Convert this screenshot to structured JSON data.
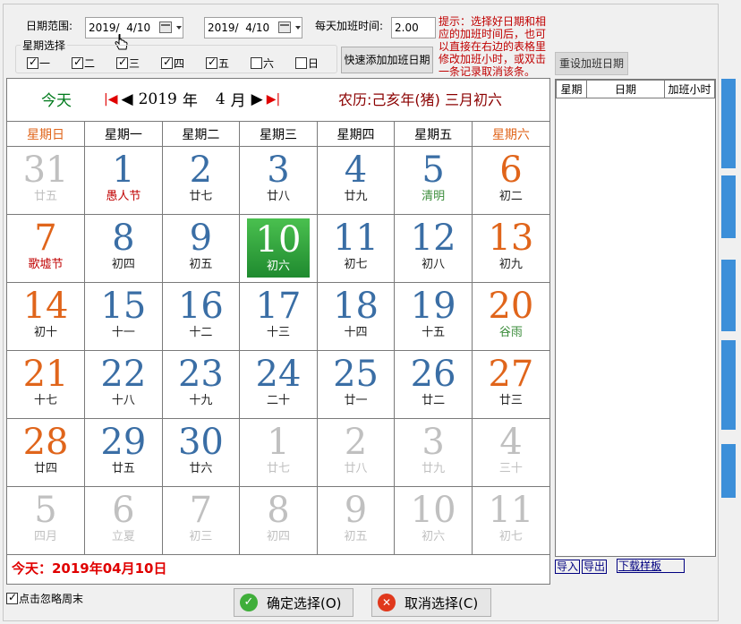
{
  "top": {
    "range_label": "日期范围:",
    "start_date": "2019/  4/10",
    "end_date": "2019/  4/10",
    "daily_ot_label": "每天加班时间:",
    "daily_ot_value": "2.00",
    "hint": "提示：选择好日期和相应的加班时间后，也可以直接在右边的表格里修改加班小时，或双击一条记录取消该条。",
    "week_legend": "星期选择",
    "week_days": [
      {
        "label": "一",
        "checked": true
      },
      {
        "label": "二",
        "checked": true
      },
      {
        "label": "三",
        "checked": true
      },
      {
        "label": "四",
        "checked": true
      },
      {
        "label": "五",
        "checked": true
      },
      {
        "label": "六",
        "checked": false
      },
      {
        "label": "日",
        "checked": false
      }
    ],
    "quick_add_label": "快速添加加班日期"
  },
  "calendar": {
    "today_button": "今天",
    "year": "2019",
    "year_unit": "年",
    "month": "4",
    "month_unit": "月",
    "lunar": "农历:己亥年(猪) 三月初六",
    "weekdays": [
      "星期日",
      "星期一",
      "星期二",
      "星期三",
      "星期四",
      "星期五",
      "星期六"
    ],
    "rows": [
      [
        {
          "d": "31",
          "l": "廿五",
          "dc": "c-gray",
          "lc": "c-gray"
        },
        {
          "d": "1",
          "l": "愚人节",
          "dc": "c-blue",
          "lc": "c-red"
        },
        {
          "d": "2",
          "l": "廿七",
          "dc": "c-blue",
          "lc": "c-black"
        },
        {
          "d": "3",
          "l": "廿八",
          "dc": "c-blue",
          "lc": "c-black"
        },
        {
          "d": "4",
          "l": "廿九",
          "dc": "c-blue",
          "lc": "c-black"
        },
        {
          "d": "5",
          "l": "清明",
          "dc": "c-blue",
          "lc": "c-green"
        },
        {
          "d": "6",
          "l": "初二",
          "dc": "c-orange",
          "lc": "c-black"
        }
      ],
      [
        {
          "d": "7",
          "l": "歌墟节",
          "dc": "c-orange",
          "lc": "c-red"
        },
        {
          "d": "8",
          "l": "初四",
          "dc": "c-blue",
          "lc": "c-black"
        },
        {
          "d": "9",
          "l": "初五",
          "dc": "c-blue",
          "lc": "c-black"
        },
        {
          "d": "10",
          "l": "初六",
          "dc": "c-blue",
          "lc": "c-black",
          "selected": true
        },
        {
          "d": "11",
          "l": "初七",
          "dc": "c-blue",
          "lc": "c-black"
        },
        {
          "d": "12",
          "l": "初八",
          "dc": "c-blue",
          "lc": "c-black"
        },
        {
          "d": "13",
          "l": "初九",
          "dc": "c-orange",
          "lc": "c-black"
        }
      ],
      [
        {
          "d": "14",
          "l": "初十",
          "dc": "c-orange",
          "lc": "c-black"
        },
        {
          "d": "15",
          "l": "十一",
          "dc": "c-blue",
          "lc": "c-black"
        },
        {
          "d": "16",
          "l": "十二",
          "dc": "c-blue",
          "lc": "c-black"
        },
        {
          "d": "17",
          "l": "十三",
          "dc": "c-blue",
          "lc": "c-black"
        },
        {
          "d": "18",
          "l": "十四",
          "dc": "c-blue",
          "lc": "c-black"
        },
        {
          "d": "19",
          "l": "十五",
          "dc": "c-blue",
          "lc": "c-black"
        },
        {
          "d": "20",
          "l": "谷雨",
          "dc": "c-orange",
          "lc": "c-green"
        }
      ],
      [
        {
          "d": "21",
          "l": "十七",
          "dc": "c-orange",
          "lc": "c-black"
        },
        {
          "d": "22",
          "l": "十八",
          "dc": "c-blue",
          "lc": "c-black"
        },
        {
          "d": "23",
          "l": "十九",
          "dc": "c-blue",
          "lc": "c-black"
        },
        {
          "d": "24",
          "l": "二十",
          "dc": "c-blue",
          "lc": "c-black"
        },
        {
          "d": "25",
          "l": "廿一",
          "dc": "c-blue",
          "lc": "c-black"
        },
        {
          "d": "26",
          "l": "廿二",
          "dc": "c-blue",
          "lc": "c-black"
        },
        {
          "d": "27",
          "l": "廿三",
          "dc": "c-orange",
          "lc": "c-black"
        }
      ],
      [
        {
          "d": "28",
          "l": "廿四",
          "dc": "c-orange",
          "lc": "c-black"
        },
        {
          "d": "29",
          "l": "廿五",
          "dc": "c-blue",
          "lc": "c-black"
        },
        {
          "d": "30",
          "l": "廿六",
          "dc": "c-blue",
          "lc": "c-black"
        },
        {
          "d": "1",
          "l": "廿七",
          "dc": "c-gray",
          "lc": "c-gray"
        },
        {
          "d": "2",
          "l": "廿八",
          "dc": "c-gray",
          "lc": "c-gray"
        },
        {
          "d": "3",
          "l": "廿九",
          "dc": "c-gray",
          "lc": "c-gray"
        },
        {
          "d": "4",
          "l": "三十",
          "dc": "c-gray",
          "lc": "c-gray"
        }
      ],
      [
        {
          "d": "5",
          "l": "四月",
          "dc": "c-gray",
          "lc": "c-gray"
        },
        {
          "d": "6",
          "l": "立夏",
          "dc": "c-gray",
          "lc": "c-gray"
        },
        {
          "d": "7",
          "l": "初三",
          "dc": "c-gray",
          "lc": "c-gray"
        },
        {
          "d": "8",
          "l": "初四",
          "dc": "c-gray",
          "lc": "c-gray"
        },
        {
          "d": "9",
          "l": "初五",
          "dc": "c-gray",
          "lc": "c-gray"
        },
        {
          "d": "10",
          "l": "初六",
          "dc": "c-gray",
          "lc": "c-gray"
        },
        {
          "d": "11",
          "l": "初七",
          "dc": "c-gray",
          "lc": "c-gray"
        }
      ]
    ],
    "today_footer": "今天：2019年04月10日"
  },
  "right_panel": {
    "reset_label": "重设加班日期",
    "columns": [
      "星期",
      "日期",
      "加班小时"
    ],
    "import_label": "导入",
    "export_label": "导出",
    "download_label": "下载样板"
  },
  "bottom": {
    "ignore_weekend_label": "点击忽略周末",
    "ignore_weekend_checked": true,
    "ok_label": "确定选择(O)",
    "cancel_label": "取消选择(C)"
  },
  "colors": {
    "weekend": "#e0651b",
    "weekday": "#3a6ea5",
    "selected": "#2a9d3a",
    "accent_red": "#e00000"
  }
}
